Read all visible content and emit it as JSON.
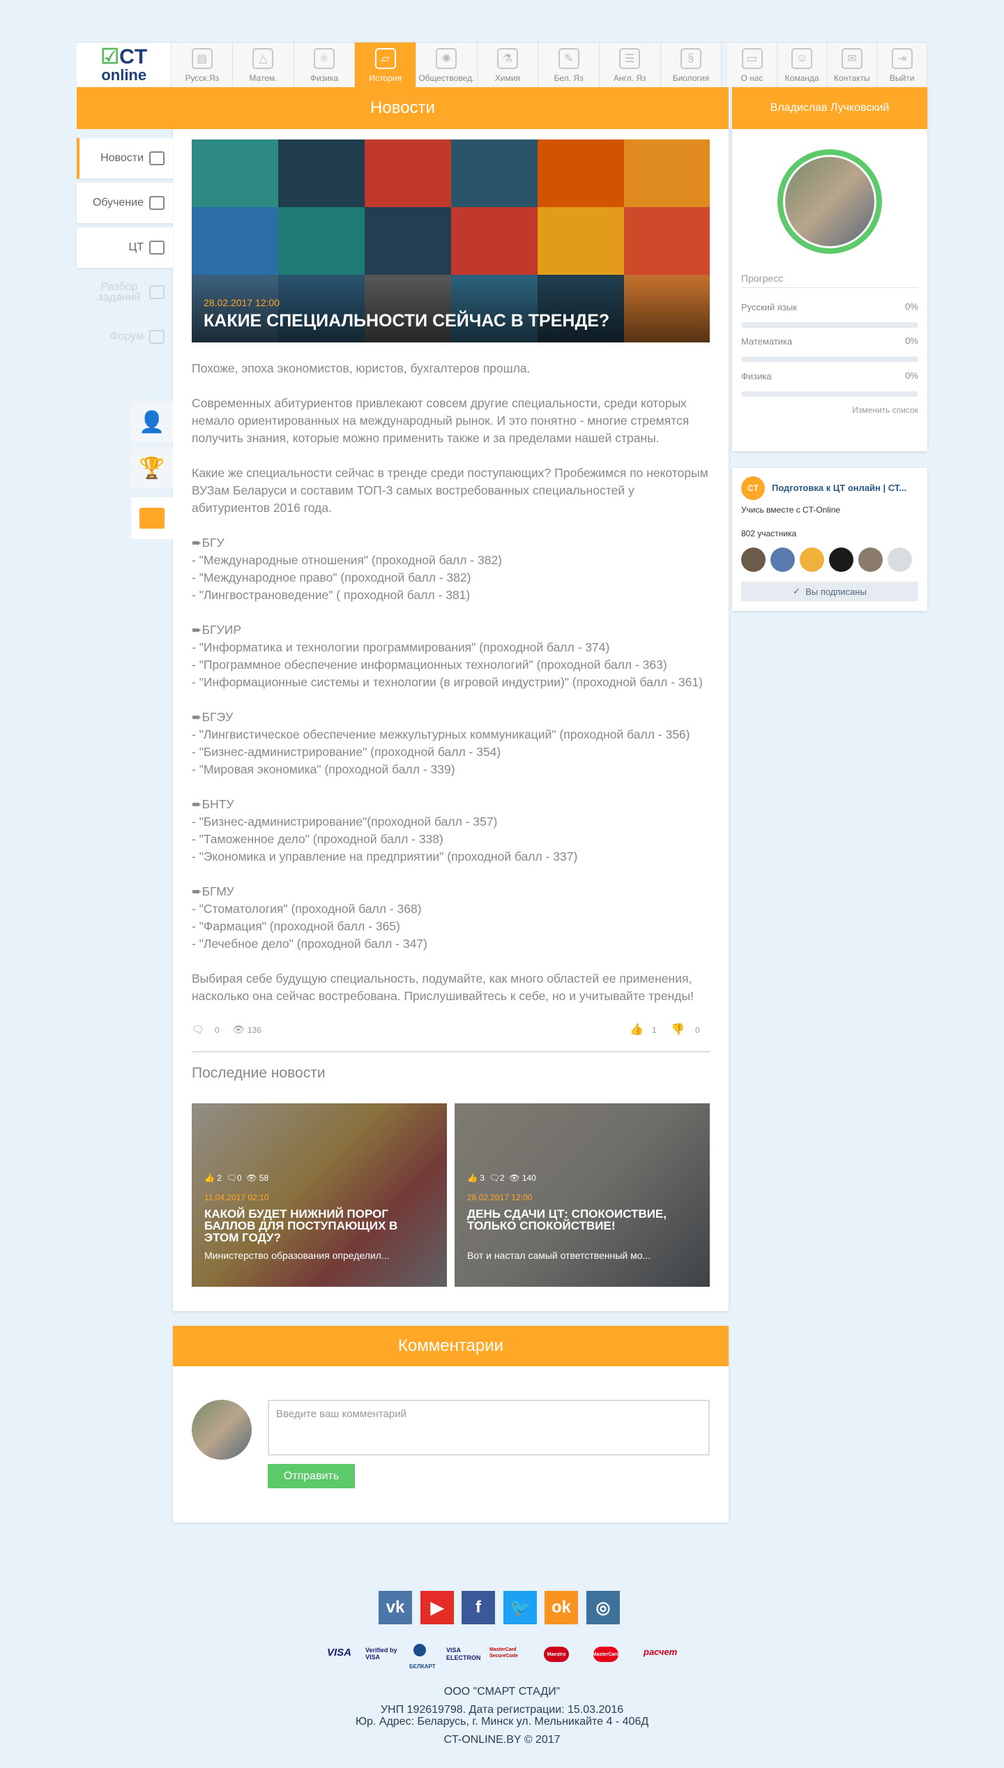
{
  "logo": {
    "line1": "CT",
    "line2": "online"
  },
  "nav": {
    "subjects": [
      "Русск.Яз",
      "Матем.",
      "Физика",
      "История",
      "Обществовед.",
      "Химия",
      "Бел. Яз",
      "Англ. Яз",
      "Биология"
    ],
    "active": "История",
    "extra": [
      "О нас",
      "Команда",
      "Контакты",
      "Выйти"
    ]
  },
  "news_header": "Новости",
  "left_menu": {
    "items": [
      "Новости",
      "Обучение",
      "ЦТ"
    ],
    "dim_items": [
      "Разбор заданий",
      "Форум"
    ]
  },
  "hero": {
    "date": "28.02.2017 12:00",
    "title": "КАКИЕ СПЕЦИАЛЬНОСТИ СЕЙЧАС В ТРЕНДЕ?"
  },
  "article": {
    "p1": "Похоже, эпоха экономистов, юристов, бухгалтеров прошла.",
    "p2": "Современных абитуриентов привлекают совсем другие специальности, среди которых немало ориентированных на международный рынок. И это понятно - многие стремятся получить знания, которые можно применить также и за пределами нашей страны.",
    "p3": "Какие же специальности сейчас в тренде среди поступающих? Пробежимся по некоторым ВУЗам Беларуси и составим ТОП-3 самых востребованных специальностей у абитуриентов 2016 года.",
    "groups": [
      {
        "name": "➨БГУ",
        "items": [
          "- \"Международные отношения\" (проходной балл - 382)",
          "- \"Международное право\" (проходной балл - 382)",
          "- \"Лингвострановедение\" ( проходной балл - 381)"
        ]
      },
      {
        "name": "➨БГУИР",
        "items": [
          "- \"Информатика и технологии программирования\" (проходной балл - 374)",
          "- \"Программное обеспечение информационных технологий\" (проходной балл - 363)",
          "- \"Информационные системы и технологии (в игровой индустрии)\" (проходной балл - 361)"
        ]
      },
      {
        "name": "➨БГЭУ",
        "items": [
          "- \"Лингвистическое обеспечение межкультурных коммуникаций\" (проходной балл - 356)",
          "- \"Бизнес-администрирование\" (проходной балл - 354)",
          "- \"Мировая экономика\" (проходной балл - 339)"
        ]
      },
      {
        "name": "➨БНТУ",
        "items": [
          "- \"Бизнес-администрирование\"(проходной балл - 357)",
          "- \"Таможенное дело\" (проходной балл - 338)",
          "- \"Экономика и управление на предприятии\" (проходной балл - 337)"
        ]
      },
      {
        "name": "➨БГМУ",
        "items": [
          "- \"Стоматология\" (проходной балл - 368)",
          "- \"Фармация\" (проходной балл - 365)",
          "- \"Лечебное дело\" (проходной балл - 347)"
        ]
      }
    ],
    "p_last": "Выбирая себе будущую специальность, подумайте, как много областей ее применения, насколько она сейчас востребована. Прислушивайтесь к себе, но и учитывайте тренды!"
  },
  "meta": {
    "comments": "0",
    "views": "136",
    "likes": "1",
    "dislikes": "0"
  },
  "latest": {
    "title": "Последние новости",
    "cards": [
      {
        "likes": "2",
        "comments": "0",
        "views": "58",
        "date": "11.04.2017 02:10",
        "title": "КАКОЙ БУДЕТ НИЖНИЙ ПОРОГ БАЛЛОВ ДЛЯ ПОСТУПАЮЩИХ В ЭТОМ ГОДУ?",
        "snippet": "Министерство образования определил..."
      },
      {
        "likes": "3",
        "comments": "2",
        "views": "140",
        "date": "28.02.2017 12:00",
        "title": "ДЕНЬ СДАЧИ ЦТ: СПОКОИСТВИЕ, ТОЛЬКО СПОКОЙСТВИЕ!",
        "snippet": "Вот и настал самый ответственный мо..."
      }
    ]
  },
  "comments": {
    "header": "Комментарии",
    "placeholder": "Введите ваш комментарий",
    "send": "Отправить"
  },
  "profile": {
    "name": "Владислав Лучковский",
    "progress_title": "Прогресс",
    "subjects": [
      {
        "name": "Русский язык",
        "value": "0%"
      },
      {
        "name": "Математика",
        "value": "0%"
      },
      {
        "name": "Физика",
        "value": "0%"
      }
    ],
    "change": "Изменить список"
  },
  "vk": {
    "title": "Подготовка к ЦТ онлайн | СТ...",
    "subtitle": "Учись вместе с CT-Online",
    "members": "802 участника",
    "subscribed": "Вы подписаны"
  },
  "footer": {
    "social": [
      "vk-icon",
      "youtube-icon",
      "facebook-icon",
      "twitter-icon",
      "odnoklassniki-icon",
      "instagram-icon"
    ],
    "payments": [
      "VISA",
      "Verified by VISA",
      "БЕЛКАРТ",
      "VISA ELECTRON",
      "MasterCard SecureCode",
      "Maestro",
      "MasterCard",
      "расчет"
    ],
    "company": "ООО \"СМАРТ СТАДИ\"",
    "unp": "УНП 192619798. Дата регистрации: 15.03.2016",
    "address": "Юр. Адрес: Беларусь, г. Минск ул. Мельникайте 4 - 406Д",
    "copyright": "CT-ONLINE.BY © 2017"
  },
  "colors": {
    "accent": "#ffa726",
    "send": "#5cc96a",
    "brand": "#1c3f7a"
  }
}
